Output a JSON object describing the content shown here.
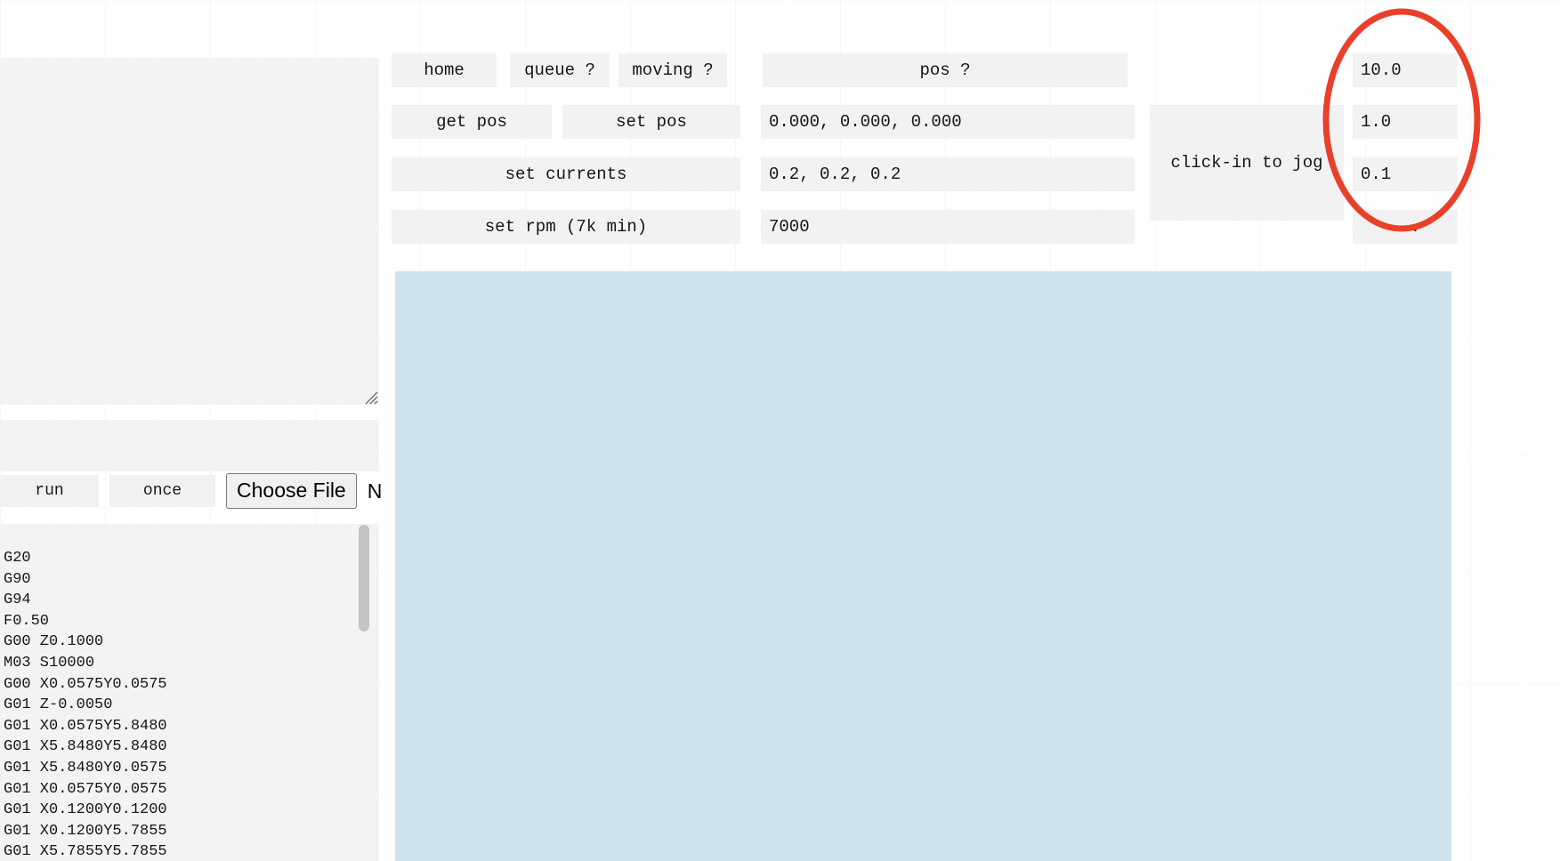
{
  "controls": {
    "row1": {
      "home_label": "home",
      "queue_label": "queue ?",
      "moving_label": "moving ?",
      "pos_label": "pos ?"
    },
    "row2": {
      "get_pos_label": "get pos",
      "set_pos_label": "set pos",
      "pos_value": "0.000, 0.000, 0.000"
    },
    "row3": {
      "set_currents_label": "set currents",
      "currents_value": "0.2, 0.2, 0.2"
    },
    "row4": {
      "set_rpm_label": "set rpm (7k min)",
      "rpm_value": "7000"
    },
    "jog": {
      "label": "click-in to jog",
      "step_coarse": "10.0",
      "step_medium": "1.0",
      "step_fine": "0.1",
      "overflow": "..."
    }
  },
  "left": {
    "console_value": "",
    "console_placeholder": "",
    "run_label": "run",
    "once_label": "once",
    "choose_file_label": "Choose File",
    "file_name_clipped": "N",
    "gcode": [
      "G20",
      "G90",
      "G94",
      "F0.50",
      "G00 Z0.1000",
      "M03 S10000",
      "G00 X0.0575Y0.0575",
      "G01 Z-0.0050",
      "G01 X0.0575Y5.8480",
      "G01 X5.8480Y5.8480",
      "G01 X5.8480Y0.0575",
      "G01 X0.0575Y0.0575",
      "G01 X0.1200Y0.1200",
      "G01 X0.1200Y5.7855",
      "G01 X5.7855Y5.7855"
    ]
  },
  "annotation": {
    "color": "#e8402a",
    "shape": "ellipse"
  },
  "colors": {
    "panel_blue": "#cde4ef",
    "control_grey": "#f2f2f2",
    "page_white": "#ffffff",
    "annotation_red": "#e8402a"
  }
}
